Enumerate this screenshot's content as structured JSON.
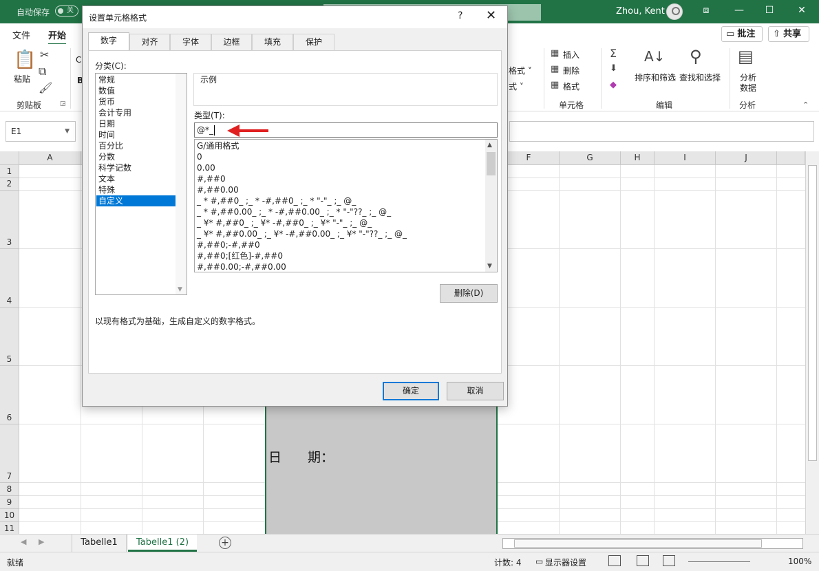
{
  "window": {
    "autosave_label": "自动保存",
    "autosave_state": "关",
    "user_name": "Zhou, Kent",
    "btn_ribbon": "⧈",
    "btn_min": "—",
    "btn_max": "☐",
    "btn_close": "✕"
  },
  "ribbon": {
    "tabs": [
      "文件",
      "开始"
    ],
    "comment_label": "批注",
    "share_label": "共享",
    "paste_label": "粘贴",
    "group_clipboard": "剪贴板",
    "font_partial": "C",
    "font_bold_partial": "B",
    "style_format_partial": "格式 ˅",
    "style_format2_partial": "式 ˅",
    "insert_label": "插入",
    "delete_label": "删除",
    "format_label": "格式",
    "group_cells": "单元格",
    "sort_label": "排序和筛选",
    "find_label": "查找和选择",
    "group_edit": "编辑",
    "analyze_label1": "分析",
    "analyze_label2": "数据",
    "group_analyze": "分析"
  },
  "formula_bar": {
    "name_box": "E1"
  },
  "grid": {
    "columns": [
      "A",
      "",
      "",
      "",
      "",
      "F",
      "G",
      "H",
      "I",
      "J"
    ],
    "rows": [
      "1",
      "2",
      "3",
      "4",
      "5",
      "6",
      "7",
      "8",
      "9",
      "10",
      "11"
    ],
    "merged_cell_text": "日　　期："
  },
  "sheets": {
    "tabs": [
      "Tabelle1",
      "Tabelle1 (2)"
    ],
    "add": "+"
  },
  "status": {
    "ready": "就绪",
    "count": "计数: 4",
    "display_settings": "显示器设置",
    "zoom": "100%"
  },
  "dialog": {
    "title": "设置单元格格式",
    "help": "?",
    "close": "✕",
    "tabs": [
      "数字",
      "对齐",
      "字体",
      "边框",
      "填充",
      "保护"
    ],
    "category_label": "分类(C):",
    "categories": [
      "常规",
      "数值",
      "货币",
      "会计专用",
      "日期",
      "时间",
      "百分比",
      "分数",
      "科学记数",
      "文本",
      "特殊",
      "自定义"
    ],
    "sample_label": "示例",
    "type_label": "类型(T):",
    "type_value": "@*_",
    "formats": [
      "G/通用格式",
      "0",
      "0.00",
      "#,##0",
      "#,##0.00",
      "_ * #,##0_ ;_ * -#,##0_ ;_ * \"-\"_ ;_ @_",
      "_ * #,##0.00_ ;_ * -#,##0.00_ ;_ * \"-\"??_ ;_ @_",
      "_ ¥* #,##0_ ;_ ¥* -#,##0_ ;_ ¥* \"-\"_ ;_ @_",
      "_ ¥* #,##0.00_ ;_ ¥* -#,##0.00_ ;_ ¥* \"-\"??_ ;_ @_",
      "#,##0;-#,##0",
      "#,##0;[红色]-#,##0",
      "#,##0.00;-#,##0.00"
    ],
    "delete_button": "删除(D)",
    "description": "以现有格式为基础，生成自定义的数字格式。",
    "ok_button": "确定",
    "cancel_button": "取消"
  },
  "colors": {
    "excel_green": "#217346",
    "selection_blue": "#0078d7",
    "annotation_arrow": "#e02020"
  }
}
